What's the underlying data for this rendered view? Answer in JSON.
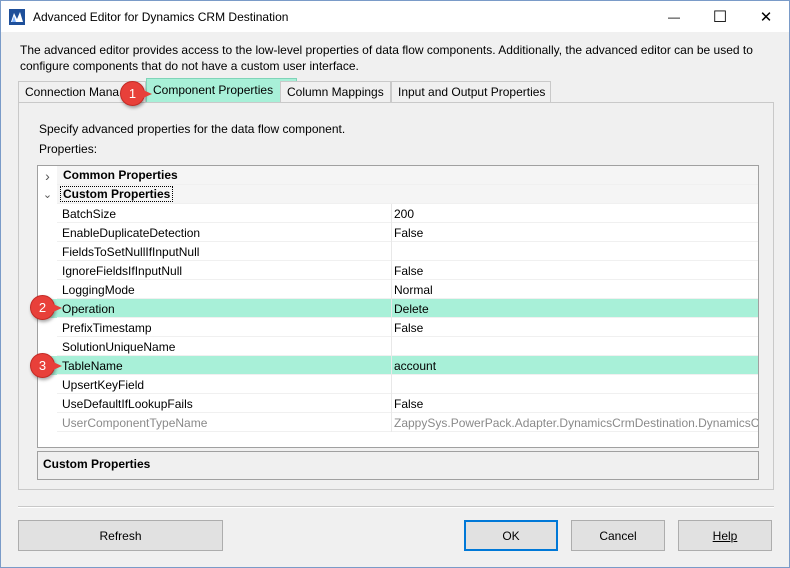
{
  "window": {
    "title": "Advanced Editor for Dynamics CRM Destination",
    "app_icon": "ssis-icon",
    "minimize_glyph": "—",
    "maximize_glyph": "☐",
    "close_glyph": "✕"
  },
  "description": "The advanced editor provides access to the low-level properties of data flow components. Additionally, the advanced editor can be used to configure components that do not have a custom user interface.",
  "tabs": [
    {
      "label": "Connection Mana",
      "active": false
    },
    {
      "label": "Component Properties",
      "active": true
    },
    {
      "label": "Column Mappings",
      "active": false
    },
    {
      "label": "Input and Output Properties",
      "active": false
    }
  ],
  "panel": {
    "description": "Specify advanced properties for the data flow component.",
    "properties_label": "Properties:"
  },
  "grid": {
    "categories": [
      {
        "label": "Common Properties",
        "expanded": false,
        "glyph": "›"
      },
      {
        "label": "Custom Properties",
        "expanded": true,
        "glyph": "⌄"
      }
    ],
    "rows": [
      {
        "name": "BatchSize",
        "value": "200"
      },
      {
        "name": "EnableDuplicateDetection",
        "value": "False"
      },
      {
        "name": "FieldsToSetNullIfInputNull",
        "value": ""
      },
      {
        "name": "IgnoreFieldsIfInputNull",
        "value": "False"
      },
      {
        "name": "LoggingMode",
        "value": "Normal"
      },
      {
        "name": "Operation",
        "value": "Delete"
      },
      {
        "name": "PrefixTimestamp",
        "value": "False"
      },
      {
        "name": "SolutionUniqueName",
        "value": ""
      },
      {
        "name": "TableName",
        "value": "account"
      },
      {
        "name": "UpsertKeyField",
        "value": ""
      },
      {
        "name": "UseDefaultIfLookupFails",
        "value": "False"
      },
      {
        "name": "UserComponentTypeName",
        "value": "ZappySys.PowerPack.Adapter.DynamicsCrmDestination.DynamicsCrm"
      }
    ],
    "highlighted_rows": [
      "Operation",
      "TableName"
    ],
    "disabled_rows": [
      "UserComponentTypeName"
    ]
  },
  "help_box": {
    "title": "Custom Properties"
  },
  "buttons": {
    "refresh": "Refresh",
    "ok": "OK",
    "cancel": "Cancel",
    "help": "Help"
  },
  "annotations": [
    {
      "number": "1",
      "target": "Component Properties tab"
    },
    {
      "number": "2",
      "target": "Operation"
    },
    {
      "number": "3",
      "target": "TableName"
    }
  ],
  "colors": {
    "highlight": "#a8f0d8",
    "badge": "#e8403a",
    "default_button_border": "#0078d7"
  }
}
